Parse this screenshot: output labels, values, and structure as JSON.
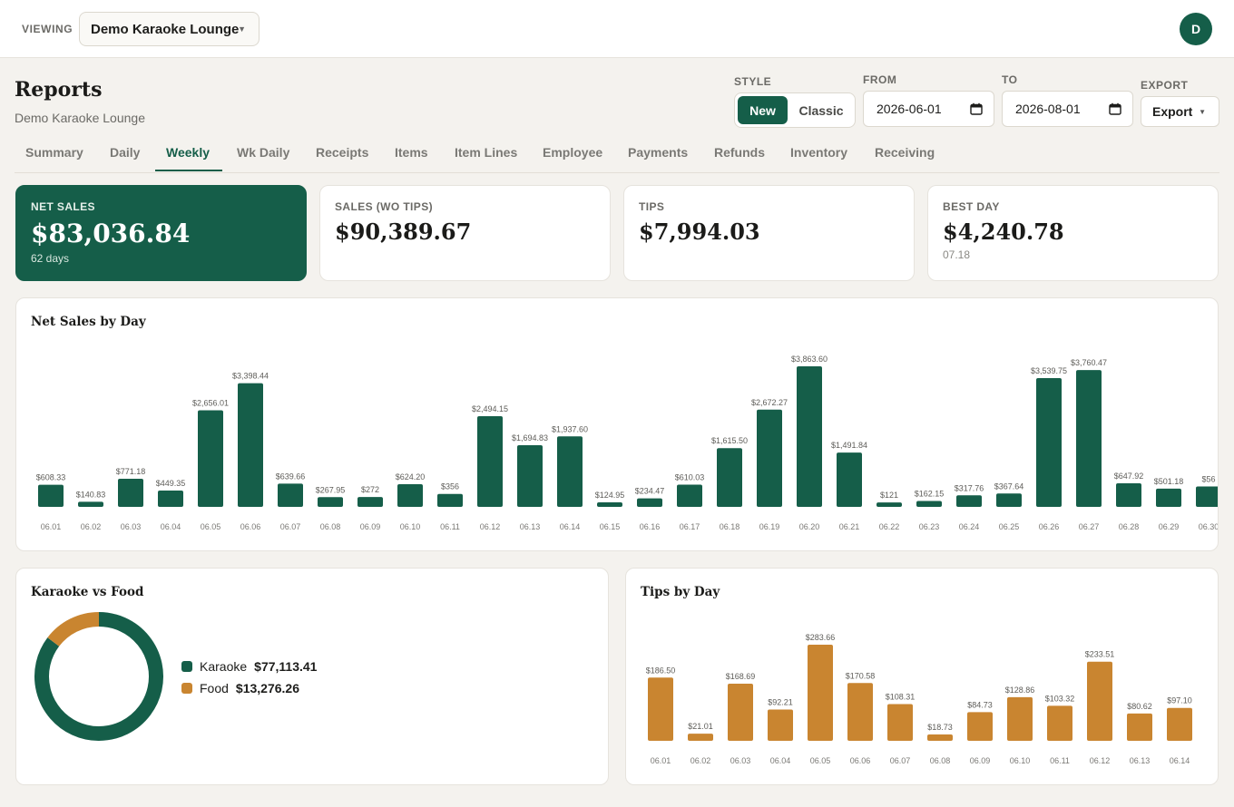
{
  "topbar": {
    "viewing_label": "VIEWING",
    "venue": "Demo Karaoke Lounge",
    "avatar_initial": "D"
  },
  "header": {
    "title": "Reports",
    "subtitle": "Demo Karaoke Lounge",
    "style_label": "STYLE",
    "style_options": [
      "New",
      "Classic"
    ],
    "style_selected": "New",
    "from_label": "FROM",
    "from_value": "2026-06-01",
    "to_label": "TO",
    "to_value": "2026-08-01",
    "export_label": "EXPORT",
    "export_button": "Export"
  },
  "tabs": [
    "Summary",
    "Daily",
    "Weekly",
    "Wk Daily",
    "Receipts",
    "Items",
    "Item Lines",
    "Employee",
    "Payments",
    "Refunds",
    "Inventory",
    "Receiving"
  ],
  "active_tab": "Weekly",
  "kpis": [
    {
      "label": "NET SALES",
      "value": "$83,036.84",
      "sub": "62 days"
    },
    {
      "label": "SALES (WO TIPS)",
      "value": "$90,389.67",
      "sub": ""
    },
    {
      "label": "TIPS",
      "value": "$7,994.03",
      "sub": ""
    },
    {
      "label": "BEST DAY",
      "value": "$4,240.78",
      "sub": "07.18"
    }
  ],
  "colors": {
    "brand_green": "#155e49",
    "tips_orange": "#c98530"
  },
  "chart_data": [
    {
      "type": "bar",
      "title": "Net Sales by Day",
      "categories": [
        "06.01",
        "06.02",
        "06.03",
        "06.04",
        "06.05",
        "06.06",
        "06.07",
        "06.08",
        "06.09",
        "06.10",
        "06.11",
        "06.12",
        "06.13",
        "06.14",
        "06.15",
        "06.16",
        "06.17",
        "06.18",
        "06.19",
        "06.20",
        "06.21",
        "06.22",
        "06.23",
        "06.24",
        "06.25",
        "06.26",
        "06.27",
        "06.28",
        "06.29",
        "06.30"
      ],
      "values": [
        608.33,
        140.83,
        771.18,
        449.35,
        2656.01,
        3398.44,
        639.66,
        267.95,
        272,
        624.2,
        356,
        2494.15,
        1694.83,
        1937.6,
        124.95,
        234.47,
        610.03,
        1615.5,
        2672.27,
        3863.6,
        1491.84,
        121,
        162.15,
        317.76,
        367.64,
        3539.75,
        3760.47,
        647.92,
        501.18,
        560
      ],
      "value_labels": [
        "$608.33",
        "$140.83",
        "$771.18",
        "$449.35",
        "$2,656.01",
        "$3,398.44",
        "$639.66",
        "$267.95",
        "$272",
        "$624.20",
        "$356",
        "$2,494.15",
        "$1,694.83",
        "$1,937.60",
        "$124.95",
        "$234.47",
        "$610.03",
        "$1,615.50",
        "$2,672.27",
        "$3,863.60",
        "$1,491.84",
        "$121",
        "$162.15",
        "$317.76",
        "$367.64",
        "$3,539.75",
        "$3,760.47",
        "$647.92",
        "$501.18",
        "$56"
      ],
      "color": "#155e49"
    },
    {
      "type": "pie",
      "title": "Karaoke vs Food",
      "labels": [
        "Karaoke",
        "Food"
      ],
      "values": [
        77113.41,
        13276.26
      ],
      "value_labels": [
        "$77,113.41",
        "$13,276.26"
      ],
      "colors": [
        "#155e49",
        "#c98530"
      ]
    },
    {
      "type": "bar",
      "title": "Tips by Day",
      "categories": [
        "06.01",
        "06.02",
        "06.03",
        "06.04",
        "06.05",
        "06.06",
        "06.07",
        "06.08",
        "06.09",
        "06.10",
        "06.11",
        "06.12",
        "06.13",
        "06.14"
      ],
      "values": [
        186.5,
        21.01,
        168.69,
        92.21,
        283.66,
        170.58,
        108.31,
        18.73,
        84.73,
        128.86,
        103.32,
        233.51,
        80.62,
        97.1
      ],
      "value_labels": [
        "$186.50",
        "$21.01",
        "$168.69",
        "$92.21",
        "$283.66",
        "$170.58",
        "$108.31",
        "$18.73",
        "$84.73",
        "$128.86",
        "$103.32",
        "$233.51",
        "$80.62",
        "$97.10"
      ],
      "color": "#c98530"
    }
  ]
}
